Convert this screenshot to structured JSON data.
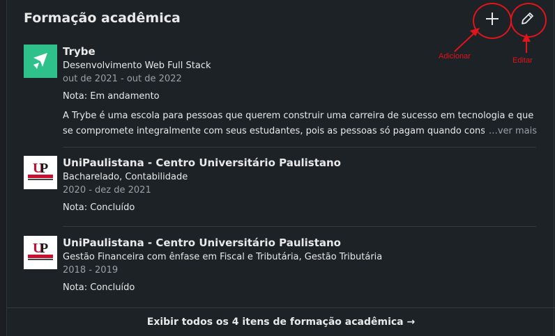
{
  "section": {
    "title": "Formação acadêmica",
    "footer_link": "Exibir todos os 4 itens de formação acadêmica →"
  },
  "annotations": {
    "add_label": "Adicionar",
    "edit_label": "Editar",
    "color": "#e0141b"
  },
  "entries": [
    {
      "school": "Trybe",
      "degree": "Desenvolvimento Web Full Stack",
      "dates": "out de 2021 - out de 2022",
      "grade": "Nota: Em andamento",
      "description": "A Trybe é uma escola para pessoas que querem construir uma carreira de sucesso em tecnologia e que se compromete integralmente com seus estudantes, pois as pessoas só pagam quando conseguire",
      "see_more": "…ver mais",
      "logo_color": "#2fc18c"
    },
    {
      "school": "UniPaulistana - Centro Universitário Paulistano",
      "degree": "Bacharelado, Contabilidade",
      "dates": "2020 - dez de 2021",
      "grade": "Nota: Concluído"
    },
    {
      "school": "UniPaulistana - Centro Universitário Paulistano",
      "degree": "Gestão Financeira com ênfase em Fiscal e Tributária, Gestão Tributária",
      "dates": "2018 - 2019",
      "grade": "Nota: Concluído"
    }
  ]
}
